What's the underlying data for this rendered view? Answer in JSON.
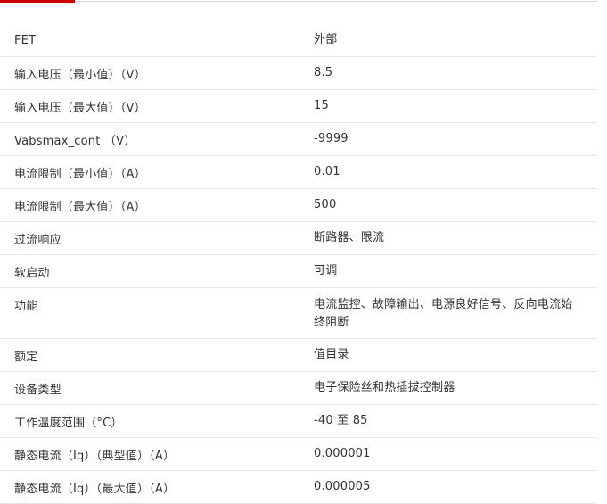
{
  "colors": {
    "accent": "#cc0000",
    "text": "#333333",
    "divider": "#e6e6e6"
  },
  "specs": [
    {
      "label": "FET",
      "value": "外部"
    },
    {
      "label": "输入电压（最小值）（V）",
      "value": "8.5"
    },
    {
      "label": "输入电压（最大值）（V）",
      "value": "15"
    },
    {
      "label": "Vabsmax_cont （V）",
      "value": "-9999"
    },
    {
      "label": "电流限制（最小值）（A）",
      "value": "0.01"
    },
    {
      "label": "电流限制（最大值）（A）",
      "value": "500"
    },
    {
      "label": "过流响应",
      "value": "断路器、限流"
    },
    {
      "label": "软启动",
      "value": "可调"
    },
    {
      "label": "功能",
      "value": "电流监控、故障输出、电源良好信号、反向电流始终阻断"
    },
    {
      "label": "额定",
      "value": "值目录"
    },
    {
      "label": "设备类型",
      "value": "电子保险丝和热插拔控制器"
    },
    {
      "label": "工作温度范围（°C）",
      "value": "-40 至 85"
    },
    {
      "label": "静态电流（Iq）（典型值）（A）",
      "value": "0.000001"
    },
    {
      "label": "静态电流（Iq）（最大值）（A）",
      "value": "0.000005"
    }
  ]
}
